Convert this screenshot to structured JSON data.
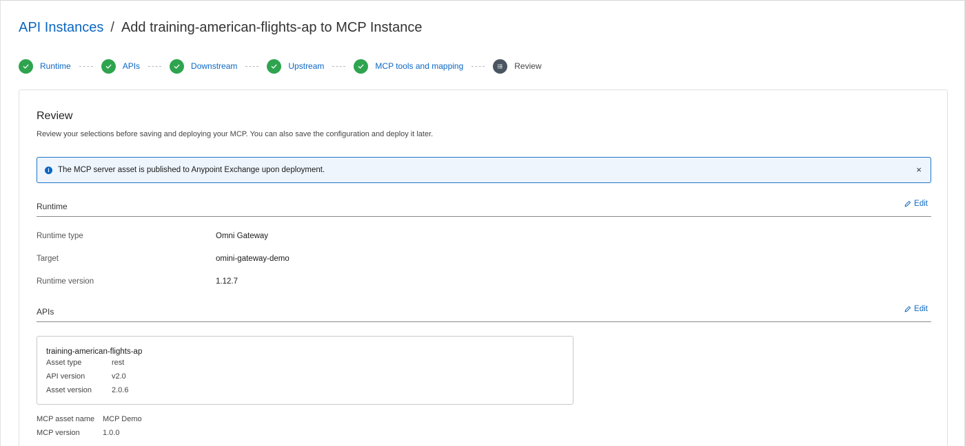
{
  "breadcrumb": {
    "parent": "API Instances",
    "separator": "/",
    "current": "Add training-american-flights-ap to MCP Instance"
  },
  "stepper": {
    "steps": [
      {
        "label": "Runtime",
        "status": "complete"
      },
      {
        "label": "APIs",
        "status": "complete"
      },
      {
        "label": "Downstream",
        "status": "complete"
      },
      {
        "label": "Upstream",
        "status": "complete"
      },
      {
        "label": "MCP tools and mapping",
        "status": "complete"
      },
      {
        "label": "Review",
        "status": "current"
      }
    ]
  },
  "review": {
    "title": "Review",
    "description": "Review your selections before saving and deploying your MCP. You can also save the configuration and deploy it later.",
    "banner": {
      "text": "The MCP server asset is published to Anypoint Exchange upon deployment.",
      "close_glyph": "×"
    }
  },
  "runtime_section": {
    "title": "Runtime",
    "edit_label": "Edit",
    "rows": [
      {
        "label": "Runtime type",
        "value": "Omni Gateway"
      },
      {
        "label": "Target",
        "value": "omini-gateway-demo"
      },
      {
        "label": "Runtime version",
        "value": "1.12.7"
      }
    ]
  },
  "apis_section": {
    "title": "APIs",
    "edit_label": "Edit",
    "api": {
      "name": "training-american-flights-ap",
      "rows": [
        {
          "label": "Asset type",
          "value": "rest"
        },
        {
          "label": "API version",
          "value": "v2.0"
        },
        {
          "label": "Asset version",
          "value": "2.0.6"
        }
      ]
    },
    "mcp_rows": [
      {
        "label": "MCP asset name",
        "value": "MCP Demo"
      },
      {
        "label": "MCP version",
        "value": "1.0.0"
      }
    ]
  },
  "colors": {
    "link": "#0b67c2",
    "step_complete": "#2ea44f",
    "step_current": "#4a5561",
    "banner_border": "#1b74c6",
    "banner_bg": "#eef5fc"
  },
  "icons": {
    "step_complete": "check-icon",
    "step_current": "list-icon",
    "banner": "info-icon",
    "close": "close-icon",
    "edit": "pencil-icon"
  }
}
